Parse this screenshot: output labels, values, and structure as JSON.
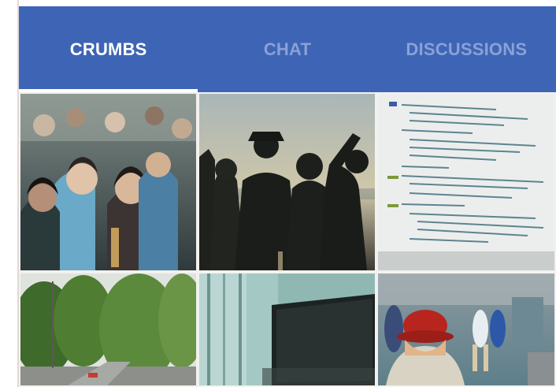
{
  "tabs": [
    {
      "label": "CRUMBS",
      "active": true
    },
    {
      "label": "CHAT",
      "active": false
    },
    {
      "label": "DISCUSSIONS",
      "active": false
    }
  ],
  "colors": {
    "tab_bar": "#3e65b5",
    "tab_active_text": "#ffffff",
    "tab_inactive_text": "#8aa1d6",
    "indicator": "#ffffff"
  },
  "photos": [
    {
      "subject": "crowd-of-people"
    },
    {
      "subject": "silhouettes-at-sunset"
    },
    {
      "subject": "source-code-on-screen"
    },
    {
      "subject": "trees-and-street"
    },
    {
      "subject": "laptop-by-window"
    },
    {
      "subject": "girl-in-red-hat"
    }
  ]
}
